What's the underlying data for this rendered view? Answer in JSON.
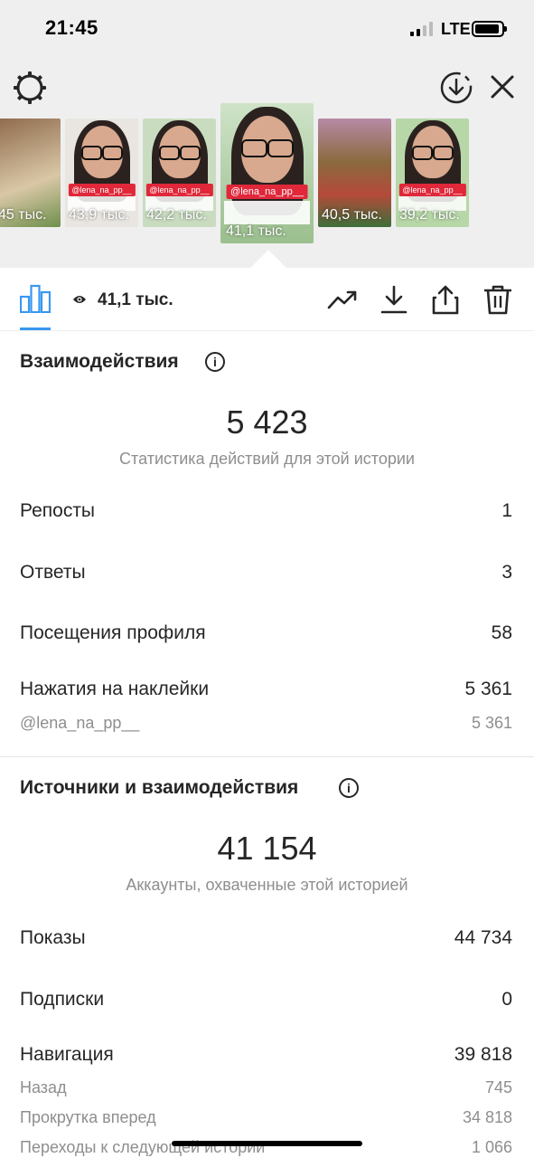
{
  "status_bar": {
    "time": "21:45",
    "network": "LTE"
  },
  "thumbnails": [
    {
      "views": "45 тыс.",
      "tag": ""
    },
    {
      "views": "43,9 тыс.",
      "tag": "@lena_na_pp__"
    },
    {
      "views": "42,2 тыс.",
      "tag": "@lena_na_pp__"
    },
    {
      "views": "41,1 тыс.",
      "tag": "@lena_na_pp__"
    },
    {
      "views": "40,5 тыс.",
      "tag": ""
    },
    {
      "views": "39,2 тыс.",
      "tag": "@lena_na_pp__"
    }
  ],
  "toolbar": {
    "views": "41,1 тыс."
  },
  "interactions": {
    "title": "Взаимодействия",
    "total": "5 423",
    "subtitle": "Статистика действий для этой истории",
    "rows": [
      {
        "label": "Репосты",
        "value": "1"
      },
      {
        "label": "Ответы",
        "value": "3"
      },
      {
        "label": "Посещения профиля",
        "value": "58"
      },
      {
        "label": "Нажатия на наклейки",
        "value": "5 361"
      }
    ],
    "sticker_sub": {
      "label": "@lena_na_pp__",
      "value": "5 361"
    }
  },
  "sources": {
    "title": "Источники и взаимодействия",
    "total": "41 154",
    "subtitle": "Аккаунты, охваченные этой историей",
    "rows": [
      {
        "label": "Показы",
        "value": "44 734"
      },
      {
        "label": "Подписки",
        "value": "0"
      },
      {
        "label": "Навигация",
        "value": "39 818"
      }
    ],
    "nav_sub": [
      {
        "label": "Назад",
        "value": "745"
      },
      {
        "label": "Прокрутка вперед",
        "value": "34 818"
      },
      {
        "label": "Переходы к следующей истории",
        "value": "1 066"
      }
    ]
  },
  "colors": {
    "accent": "#3897f0",
    "tag_red": "#e0283a"
  }
}
